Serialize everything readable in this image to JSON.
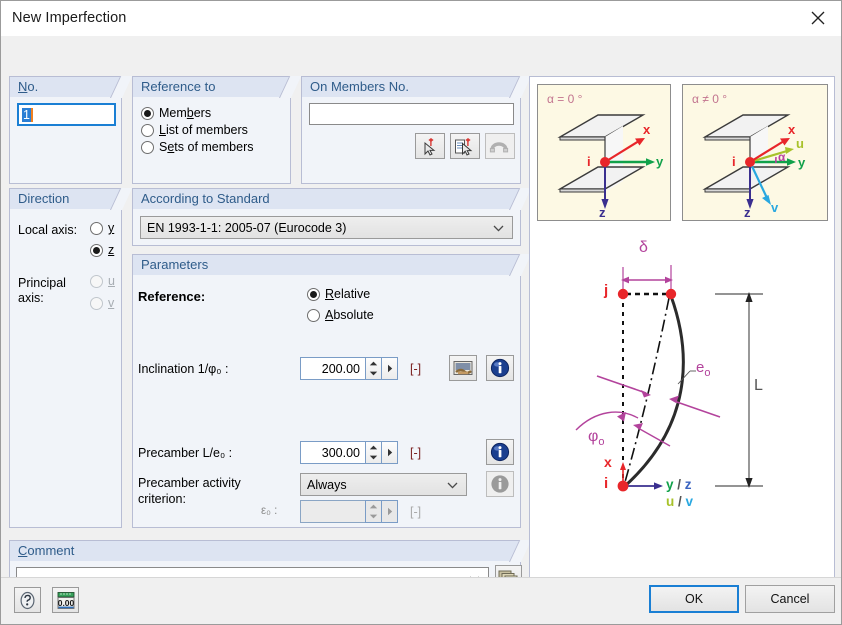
{
  "window": {
    "title": "New Imperfection",
    "close_label": "close-icon"
  },
  "groups": {
    "no": {
      "title": "No.",
      "value": "1"
    },
    "reference_to": {
      "title": "Reference to",
      "options": [
        {
          "label": "Members",
          "selected": true
        },
        {
          "label": "List of members",
          "selected": false
        },
        {
          "label": "Sets of members",
          "selected": false
        }
      ]
    },
    "on_members": {
      "title": "On Members No.",
      "value": "",
      "buttons": [
        {
          "name": "pick-members-button",
          "enabled": true
        },
        {
          "name": "pick-members-from-list-button",
          "enabled": true
        },
        {
          "name": "magnet-button",
          "enabled": false
        }
      ]
    },
    "direction": {
      "title": "Direction",
      "local_axis_label": "Local axis:",
      "local_axis_options": [
        {
          "label": "y",
          "selected": false,
          "enabled": true
        },
        {
          "label": "z",
          "selected": true,
          "enabled": true
        }
      ],
      "principal_axis_label": "Principal axis:",
      "principal_axis_options": [
        {
          "label": "u",
          "selected": false,
          "enabled": false
        },
        {
          "label": "v",
          "selected": false,
          "enabled": false
        }
      ]
    },
    "standard": {
      "title": "According to Standard",
      "selected": "EN 1993-1-1: 2005-07  (Eurocode 3)"
    },
    "parameters": {
      "title": "Parameters",
      "reference_label": "Reference:",
      "reference_options": [
        {
          "label": "Relative",
          "selected": true
        },
        {
          "label": "Absolute",
          "selected": false
        }
      ],
      "inclination_label": "Inclination 1/φ₀ :",
      "inclination_value": "200.00",
      "inclination_unit": "[-]",
      "precamber_label": "Precamber L/e₀ :",
      "precamber_value": "300.00",
      "precamber_unit": "[-]",
      "criterion_label_line1": "Precamber activity",
      "criterion_label_line2": "criterion:",
      "criterion_value": "Always",
      "epsilon_label": "ε₀ :",
      "epsilon_value": "",
      "epsilon_unit": "[-]"
    },
    "comment": {
      "title": "Comment",
      "value": "",
      "button_name": "comment-library-button"
    }
  },
  "diagram": {
    "top_left_caption": "α = 0 °",
    "top_right_caption": "α ≠ 0 °",
    "axis_labels": {
      "x": "x",
      "y": "y",
      "z": "z",
      "u": "u",
      "v": "v",
      "alpha": "α",
      "node_i": "i",
      "node_j": "j"
    },
    "bottom": {
      "delta": "δ",
      "e0": "e",
      "e0_sub": "o",
      "phi0": "φ",
      "phi0_sub": "o",
      "length": "L",
      "node_i": "i",
      "node_j": "j",
      "axis_x": "x",
      "axis_yz": "y / z",
      "axis_uv": "u / v"
    },
    "colors": {
      "x_axis": "#e8262a",
      "y_axis": "#11a14a",
      "z_axis": "#3a2f8f",
      "u_axis": "#a8c22a",
      "v_axis": "#29a8e0",
      "alpha": "#b83fa0",
      "dimension": "#b3439c",
      "node": "#e8262a",
      "member": "#2b2b2b",
      "background": "#fdf6d8"
    }
  },
  "footer": {
    "help_button": "help-button",
    "units_button": "units-button",
    "ok_label": "OK",
    "cancel_label": "Cancel"
  }
}
